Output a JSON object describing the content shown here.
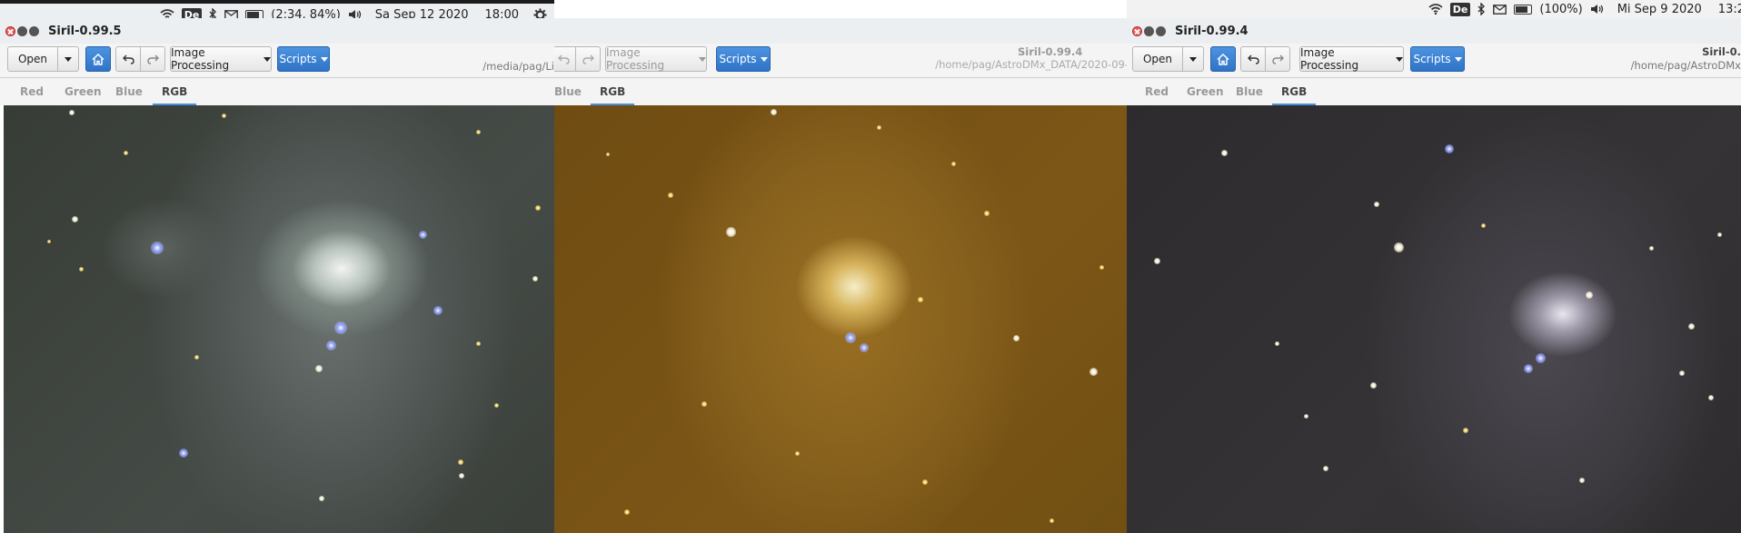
{
  "windows": [
    {
      "title": "Siril-0.99.5",
      "toolbar": {
        "open": "Open",
        "image_processing": "Image Processing",
        "scripts": "Scripts",
        "path": "/media/pag/Li"
      },
      "tabs": [
        "Red",
        "Green",
        "Blue",
        "RGB"
      ],
      "active_tab": "RGB",
      "system_bar": {
        "keyboard": "De",
        "battery": "(2:34, 84%)",
        "date": "Sa Sep 12 2020",
        "time": "18:00"
      }
    },
    {
      "title": "Siril-0.99.4",
      "toolbar": {
        "image_processing": "Image Processing",
        "scripts": "Scripts",
        "path": "/home/pag/AstroDMx_DATA/2020-09-"
      },
      "tabs": [
        "Blue",
        "RGB"
      ],
      "active_tab": "RGB"
    },
    {
      "title": "Siril-0.99.4",
      "toolbar": {
        "open": "Open",
        "image_processing": "Image Processing",
        "scripts": "Scripts",
        "version": "Siril-0.",
        "path": "/home/pag/AstroDMx"
      },
      "tabs": [
        "Red",
        "Green",
        "Blue",
        "RGB"
      ],
      "active_tab": "RGB",
      "system_bar": {
        "keyboard": "De",
        "battery": "(100%)",
        "date": "Mi Sep  9 2020",
        "time": "13:2"
      }
    }
  ],
  "colors": {
    "accent": "#3579d0",
    "tab_underline": "#4a8fd8"
  }
}
